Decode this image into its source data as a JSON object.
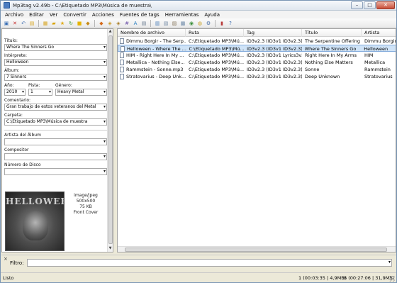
{
  "window": {
    "title": "Mp3tag v2.49b  -  C:\\Etiquetado MP3\\Música de muestra\\"
  },
  "menu": [
    "Archivo",
    "Editar",
    "Ver",
    "Convertir",
    "Acciones",
    "Fuentes de tags",
    "Herramientas",
    "Ayuda"
  ],
  "toolbar_icons": [
    {
      "name": "save-icon",
      "glyph": "▣",
      "color": "#3a6fb5"
    },
    {
      "name": "delete-icon",
      "glyph": "✕",
      "color": "#c62828"
    },
    {
      "name": "undo-icon",
      "glyph": "↶",
      "color": "#2b5fa8"
    },
    {
      "name": "change-directory-icon",
      "glyph": "▤",
      "color": "#d7a520"
    },
    {
      "name": "add-directory-icon",
      "glyph": "▦",
      "color": "#d7a520"
    },
    {
      "name": "open-folder-icon",
      "glyph": "▰",
      "color": "#d9a300"
    },
    {
      "name": "favorites-icon",
      "glyph": "★",
      "color": "#e0a800"
    },
    {
      "name": "refresh-icon",
      "glyph": "↻",
      "color": "#3d9a3d"
    },
    {
      "name": "folder-icon",
      "glyph": "■",
      "color": "#e6b400"
    },
    {
      "name": "convert-tag-filename-icon",
      "glyph": "◆",
      "color": "#c68a18"
    },
    {
      "name": "convert-filename-tag-icon",
      "glyph": "◆",
      "color": "#d46a1a"
    },
    {
      "name": "convert-text-tag-icon",
      "glyph": "◈",
      "color": "#c99a25"
    },
    {
      "name": "convert-tag-tag-icon",
      "glyph": "◈",
      "color": "#a87a20"
    },
    {
      "name": "autonumber-icon",
      "glyph": "#",
      "color": "#6b4fa8"
    },
    {
      "name": "case-conversion-icon",
      "glyph": "A",
      "color": "#2a7fc0"
    },
    {
      "name": "playlist-icon",
      "glyph": "▤",
      "color": "#6a7c91"
    },
    {
      "name": "export-icon",
      "glyph": "▥",
      "color": "#4d7fb8"
    },
    {
      "name": "text-file-icon",
      "glyph": "▧",
      "color": "#7a8fa8"
    },
    {
      "name": "cover-art-icon",
      "glyph": "▨",
      "color": "#8a7a60"
    },
    {
      "name": "tag-sources-icon",
      "glyph": "▩",
      "color": "#6e8aa9"
    },
    {
      "name": "freedb-icon",
      "glyph": "◉",
      "color": "#3a8f3a"
    },
    {
      "name": "web-sources-icon",
      "glyph": "◍",
      "color": "#c9a227"
    },
    {
      "name": "options-icon",
      "glyph": "⚙",
      "color": "#4a6fa5"
    },
    {
      "name": "info-icon",
      "glyph": "▮",
      "color": "#b83a3a"
    },
    {
      "name": "help-icon",
      "glyph": "?",
      "color": "#2b5fa8"
    }
  ],
  "tag_panel": {
    "title_label": "Título:",
    "title_value": "Where The Sinners Go",
    "artist_label": "Intérprete:",
    "artist_value": "Helloween",
    "album_label": "Álbum:",
    "album_value": "7 Sinners",
    "year_label": "Año:",
    "year_value": "2010",
    "track_label": "Pista:",
    "track_value": "1",
    "genre_label": "Género:",
    "genre_value": "Heavy Metal",
    "comment_label": "Comentario:",
    "comment_value": "Gran trabajo de estos veteranos del Metal",
    "folder_label": "Carpeta:",
    "folder_value": "C:\\Etiquetado MP3\\Música de muestra",
    "album_artist_label": "Artista del Álbum",
    "album_artist_value": "",
    "composer_label": "Compositor",
    "composer_value": "",
    "disc_label": "Número de Disco",
    "disc_value": "",
    "cover_logo_text": "HELLOWEEN",
    "cover_info": {
      "mime": "image/jpeg",
      "dims": "500x500",
      "size": "75 KB",
      "type": "Front Cover"
    }
  },
  "file_list": {
    "columns": [
      "Nombre de archivo",
      "Ruta",
      "Tag",
      "Título",
      "Artista"
    ],
    "rows": [
      [
        "Dimmu Borgir - The Serp...",
        "C:\\Etiquetado MP3\\Mú...",
        "ID3v2.3 (ID3v1 ID3v2.3)",
        "The Serpentine Offering",
        "Dimmu Borgir"
      ],
      [
        "Helloween - Where The ...",
        "C:\\Etiquetado MP3\\Mú...",
        "ID3v2.3 (ID3v1 ID3v2.3)",
        "Where The Sinners Go",
        "Helloween"
      ],
      [
        "HIM - Right Here In My ...",
        "C:\\Etiquetado MP3\\Mú...",
        "ID3v2.3 (ID3v1 Lyrics3v2...",
        "Right Here In My Arms",
        "HIM"
      ],
      [
        "Metallica - Nothing Else...",
        "C:\\Etiquetado MP3\\Mú...",
        "ID3v2.3 (ID3v1 ID3v2.3)",
        "Nothing Else Matters",
        "Metallica"
      ],
      [
        "Rammstein - Sonne.mp3",
        "C:\\Etiquetado MP3\\Mú...",
        "ID3v2.3 (ID3v1 ID3v2.3)",
        "Sonne",
        "Rammstein"
      ],
      [
        "Stratovarius - Deep Unk...",
        "C:\\Etiquetado MP3\\Mú...",
        "ID3v2.3 (ID3v1 ID3v2.3)",
        "Deep Unknown",
        "Stratovarius"
      ]
    ],
    "selected_index": 1
  },
  "filter": {
    "label": "Filtro:",
    "close_glyph": "×",
    "value": ""
  },
  "status": {
    "left": "Listo",
    "selection": "1 (00:03:35 | 4,9MB)",
    "total": "6 (00:27:06 | 31,9MB)"
  }
}
